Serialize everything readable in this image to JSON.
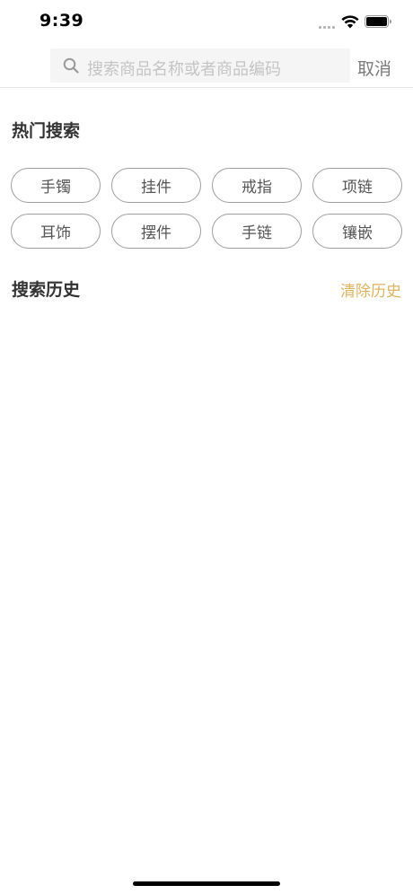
{
  "status_bar": {
    "time": "9:39",
    "icons": [
      "signal-icon",
      "wifi-icon",
      "battery-icon"
    ]
  },
  "search": {
    "placeholder": "搜索商品名称或者商品编码",
    "cancel_label": "取消",
    "icon": "search-icon"
  },
  "hot_search": {
    "title": "热门搜索",
    "tags": [
      "手镯",
      "挂件",
      "戒指",
      "项链",
      "耳饰",
      "摆件",
      "手链",
      "镶嵌"
    ]
  },
  "history": {
    "title": "搜索历史",
    "clear_label": "清除历史",
    "items": []
  },
  "colors": {
    "accent": "#e0b35f",
    "text": "#333333",
    "border": "#9e9e9e",
    "search_bg": "#f5f5f5"
  }
}
